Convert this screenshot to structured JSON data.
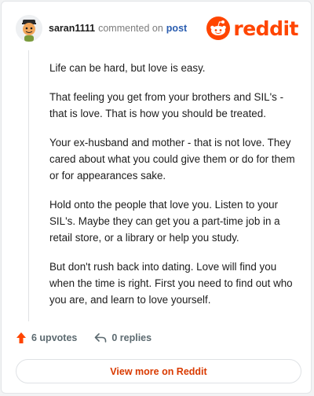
{
  "comment": {
    "username": "saran1111",
    "action_text": "commented on",
    "post_link": "post",
    "brand": "reddit",
    "paragraphs": [
      "Life can be hard, but love is easy.",
      "That feeling you get from your brothers and SIL's - that is love. That is how you should be treated.",
      "Your ex-husband and mother - that is not love. They cared about what you could give them or do for them or for appearances sake.",
      "Hold onto the people that love you. Listen to your SIL's. Maybe they can get you a part-time job in a retail store, or a library or help you study.",
      "But don't rush back into dating. Love will find you when the time is right. First you need to find out who you are, and learn to love yourself."
    ],
    "upvotes": "6 upvotes",
    "replies": "0 replies",
    "view_more": "View more on Reddit"
  },
  "colors": {
    "brand": "#ff4500",
    "upvote": "#ff4500",
    "link": "#d93a00"
  },
  "icons": [
    "avatar",
    "reddit-logo-icon",
    "upvote-arrow-icon",
    "reply-arrow-icon"
  ]
}
